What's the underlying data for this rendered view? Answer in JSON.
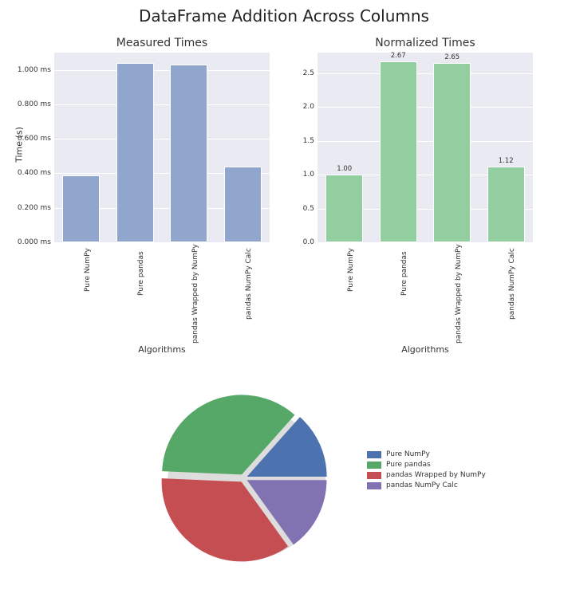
{
  "suptitle": "DataFrame Addition Across Columns",
  "left": {
    "title": "Measured Times",
    "xlabel": "Algorithms",
    "ylabel": "Time (s)",
    "yticks": [
      "0.000 ms",
      "0.200 ms",
      "0.400 ms",
      "0.600 ms",
      "0.800 ms",
      "1.000 ms"
    ]
  },
  "right": {
    "title": "Normalized Times",
    "xlabel": "Algorithms",
    "yticks": [
      "0.0",
      "0.5",
      "1.0",
      "1.5",
      "2.0",
      "2.5"
    ],
    "labels": [
      "1.00",
      "2.67",
      "2.65",
      "1.12"
    ]
  },
  "categories": [
    "Pure NumPy",
    "Pure pandas",
    "pandas Wrapped by NumPy",
    "pandas NumPy Calc"
  ],
  "legend_title": "",
  "colors": {
    "blue": "#4c72b0",
    "green": "#55a868",
    "red": "#c44e52",
    "purple": "#8172b2"
  },
  "chart_data": [
    {
      "type": "bar",
      "title": "Measured Times",
      "xlabel": "Algorithms",
      "ylabel": "Time (s)",
      "categories": [
        "Pure NumPy",
        "Pure pandas",
        "pandas Wrapped by NumPy",
        "pandas NumPy Calc"
      ],
      "values": [
        0.00039,
        0.00104,
        0.00103,
        0.00044
      ],
      "ylim": [
        0.0,
        0.0011
      ],
      "ytick_format": "ms"
    },
    {
      "type": "bar",
      "title": "Normalized Times",
      "xlabel": "Algorithms",
      "ylabel": "",
      "categories": [
        "Pure NumPy",
        "Pure pandas",
        "pandas Wrapped by NumPy",
        "pandas NumPy Calc"
      ],
      "values": [
        1.0,
        2.67,
        2.65,
        1.12
      ],
      "ylim": [
        0.0,
        2.8
      ]
    },
    {
      "type": "pie",
      "categories": [
        "Pure NumPy",
        "Pure pandas",
        "pandas Wrapped by NumPy",
        "pandas NumPy Calc"
      ],
      "values": [
        1.0,
        2.67,
        2.65,
        1.12
      ],
      "explode": [
        0.05,
        0.05,
        0.05,
        0.05
      ],
      "colors": [
        "#4c72b0",
        "#55a868",
        "#c44e52",
        "#8172b2"
      ]
    }
  ]
}
